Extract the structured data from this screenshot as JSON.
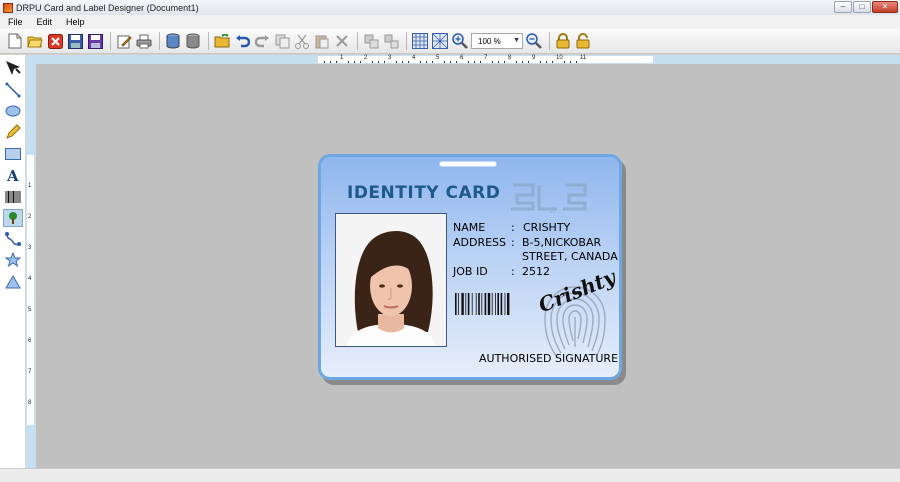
{
  "window": {
    "title": "DRPU Card and Label Designer  (Document1)",
    "minimize_glyph": "–",
    "maximize_glyph": "□",
    "close_glyph": "✕"
  },
  "menu": {
    "items": [
      "File",
      "Edit",
      "Help"
    ]
  },
  "toolbar": {
    "zoom_value": "100 %",
    "icons": [
      "new-icon",
      "open-icon",
      "close-icon",
      "save-icon",
      "save-as-icon",
      "edit-icon",
      "print-icon",
      "database-icon",
      "import-icon",
      "folder-icon",
      "undo-icon",
      "redo-icon",
      "copy-icon",
      "cut-icon",
      "paste-icon",
      "delete-icon",
      "group-icon",
      "ungroup-icon",
      "grid-icon",
      "snap-icon",
      "zoom-in-icon",
      "zoom-out-icon",
      "lock-icon",
      "unlock-icon"
    ]
  },
  "left_tools": [
    "select-icon",
    "line-icon",
    "ellipse-icon",
    "pencil-icon",
    "rectangle-icon",
    "text-icon",
    "barcode-icon",
    "picture-icon",
    "curve-icon",
    "star-icon",
    "triangle-icon"
  ],
  "ruler": {
    "h_labels": [
      "1",
      "2",
      "3",
      "4",
      "5",
      "6",
      "7",
      "8",
      "9",
      "10",
      "11"
    ],
    "v_labels": [
      "1",
      "2",
      "3",
      "4",
      "5",
      "6",
      "7",
      "8"
    ]
  },
  "card": {
    "title": "IDENTITY CARD",
    "logo_text": "SLS",
    "name_label": "NAME",
    "name_colon": ":",
    "name_value": "CRISHTY",
    "address_label": "ADDRESS",
    "address_colon": ":",
    "address_line1": "B-5,NICKOBAR",
    "address_line2": "STREET, CANADA",
    "jobid_label": "JOB ID",
    "jobid_colon": ":",
    "jobid_value": "2512",
    "signature": "Crishty",
    "authorised": "AUTHORISED SIGNATURE",
    "accent": "#1f5a8c",
    "border": "#6ea8e2"
  }
}
